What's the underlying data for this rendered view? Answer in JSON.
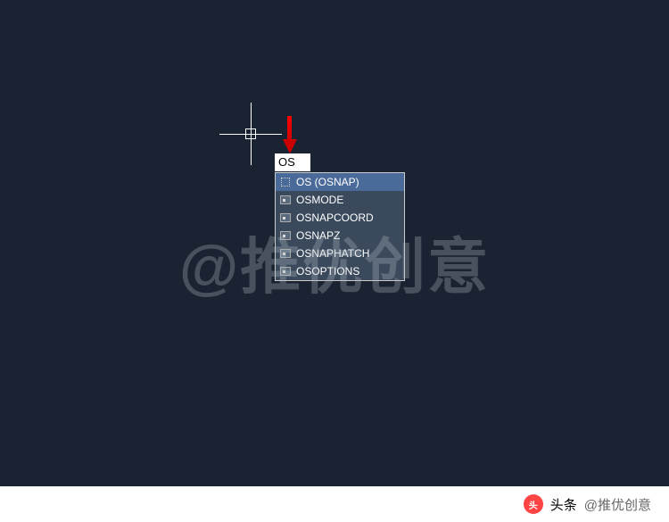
{
  "input": {
    "value": "OS"
  },
  "dropdown": {
    "items": [
      {
        "label": "OS (OSNAP)",
        "selected": true,
        "icon": "square"
      },
      {
        "label": "OSMODE",
        "selected": false,
        "icon": "var"
      },
      {
        "label": "OSNAPCOORD",
        "selected": false,
        "icon": "var"
      },
      {
        "label": "OSNAPZ",
        "selected": false,
        "icon": "var"
      },
      {
        "label": "OSNAPHATCH",
        "selected": false,
        "icon": "var"
      },
      {
        "label": "OSOPTIONS",
        "selected": false,
        "icon": "var"
      }
    ]
  },
  "watermark": {
    "text": "@推优创意"
  },
  "footer": {
    "logo_text": "头",
    "label": "头条",
    "handle": "@推优创意"
  }
}
